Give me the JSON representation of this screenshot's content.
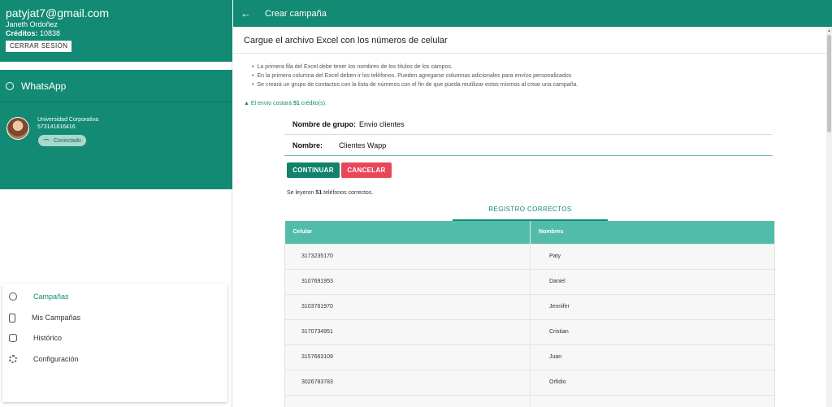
{
  "user": {
    "email": "patyjat7@gmail.com",
    "name": "Janeth Ordoñez",
    "credits_label": "Créditos:",
    "credits_value": "10838",
    "logout_label": "CERRAR SESIÓN"
  },
  "whatsapp": {
    "title": "WhatsApp",
    "account_name": "Universidad Corporativa",
    "phone": "573141816416",
    "status": "Conectado"
  },
  "menu": {
    "items": [
      {
        "label": "Campañas",
        "icon": "whatsapp-icon"
      },
      {
        "label": "Mis Campañas",
        "icon": "phone-icon"
      },
      {
        "label": "Histórico",
        "icon": "database-icon"
      },
      {
        "label": "Configuración",
        "icon": "gear-icon"
      }
    ]
  },
  "header": {
    "title": "Crear campaña"
  },
  "main": {
    "card_title": "Cargue el archivo Excel con los números de celular",
    "notes": [
      "La primera fila del Excel debe tener los nombres de los títulos de los campos.",
      "En la primera columna del Excel deben ir los teléfonos. Pueden agregarse columnas adicionales para envíos personalizados",
      "Se creará un grupo de contactos con la lista de números con el fin de que pueda reutilizar estos mismos al crear una campaña."
    ],
    "cost_prefix": "▲ El envío costará ",
    "cost_value": "51",
    "cost_suffix": " crédito(s).",
    "group_label": "Nombre de grupo:",
    "group_value": "Envio clientes",
    "name_label": "Nombre:",
    "name_value": "Clientes Wapp",
    "continue_label": "CONTINUAR",
    "cancel_label": "CANCELAR",
    "read_prefix": "Se leyeron ",
    "read_count": "51",
    "read_suffix": " teléfonos correctos.",
    "tab_label": "REGISTRO CORRECTOS"
  },
  "table": {
    "headers": [
      "Celular",
      "Nombres"
    ],
    "rows": [
      [
        "3173235170",
        "Paty"
      ],
      [
        "3107691953",
        "Daniel"
      ],
      [
        "3103761970",
        "Jennifer"
      ],
      [
        "3170734951",
        "Cristian"
      ],
      [
        "3157663109",
        "Juan"
      ],
      [
        "3026783783",
        "Orfidio"
      ],
      [
        "",
        ""
      ]
    ]
  }
}
